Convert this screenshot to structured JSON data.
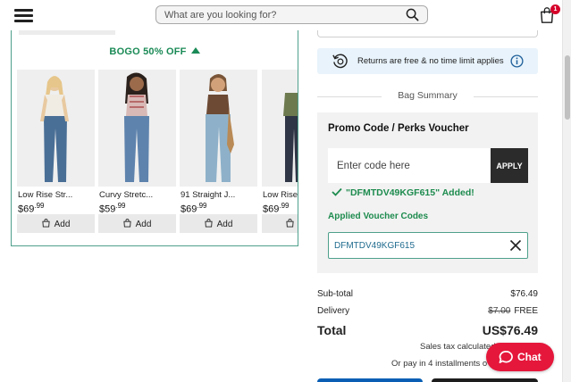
{
  "header": {
    "search_placeholder": "What are you looking for?",
    "bag_count": "1"
  },
  "bogo": {
    "title": "BOGO 50% OFF",
    "products": [
      {
        "name": "Low Rise Str...",
        "price_main": "$69",
        "price_cents": ".99",
        "add_label": "Add"
      },
      {
        "name": "Curvy Stretc...",
        "price_main": "$59",
        "price_cents": ".99",
        "add_label": "Add"
      },
      {
        "name": "91 Straight J...",
        "price_main": "$69",
        "price_cents": ".99",
        "add_label": "Add"
      },
      {
        "name": "Low Rise",
        "price_main": "$69",
        "price_cents": ".99",
        "add_label": ""
      }
    ]
  },
  "returns": {
    "text": "Returns are free & no time limit applies"
  },
  "summary": {
    "heading": "Bag Summary",
    "promo_title": "Promo Code / Perks Voucher",
    "code_placeholder": "Enter code here",
    "apply_label": "APPLY",
    "added_message": "\"DFMTDV49KGF615\" Added!",
    "applied_label": "Applied Voucher Codes",
    "voucher_code": "DFMTDV49KGF615"
  },
  "totals": {
    "subtotal_label": "Sub-total",
    "subtotal_value": "$76.49",
    "delivery_label": "Delivery",
    "delivery_old": "$7.00",
    "delivery_value": "FREE",
    "total_label": "Total",
    "total_value": "US$76.49",
    "tax_text": "Sales tax calculated",
    "installments_text": "Or pay in 4 installments o"
  },
  "chat": {
    "label": "Chat"
  },
  "colors": {
    "accent_green": "#1a8a56",
    "chat_red": "#e5173b",
    "border_teal": "#4fa08c"
  }
}
